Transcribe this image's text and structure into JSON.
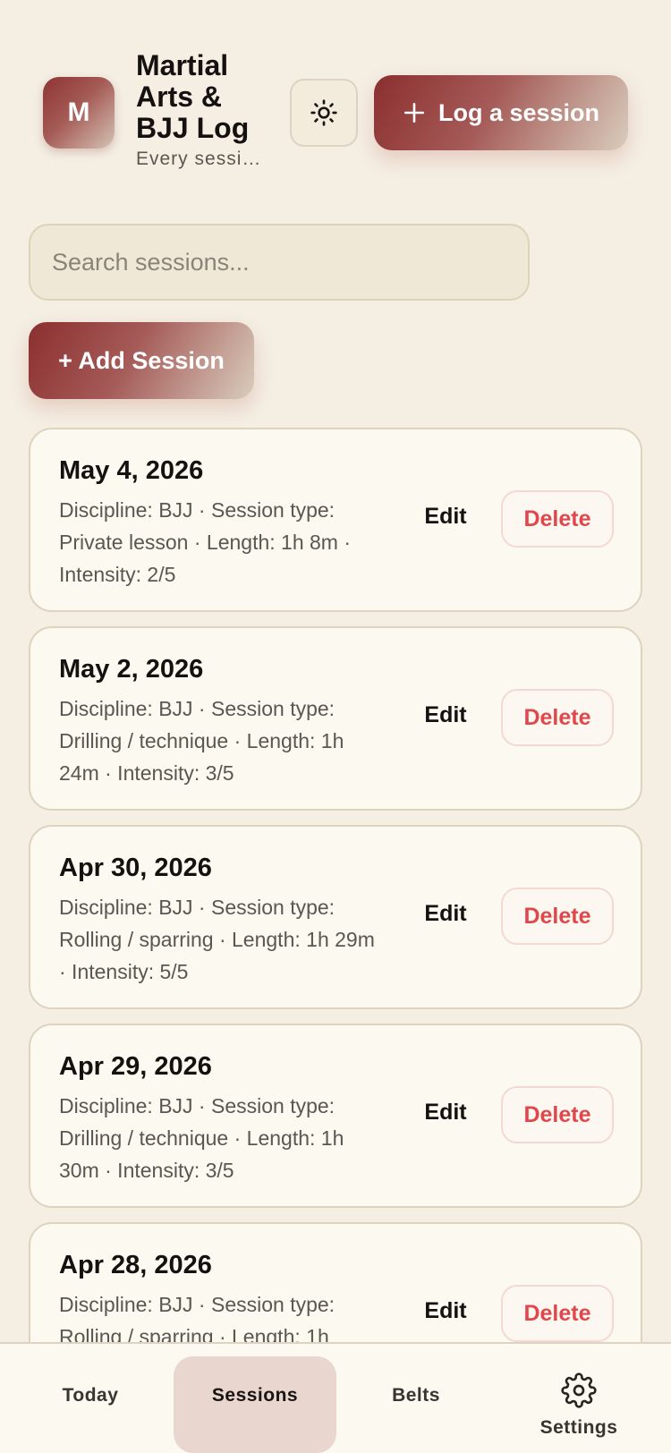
{
  "header": {
    "avatar_letter": "M",
    "title": "Martial Arts & BJJ Log",
    "subtitle": "Every sessi…",
    "theme_icon": "sun-icon",
    "log_button_icon": "plus-icon",
    "log_button_label": "Log a session"
  },
  "search": {
    "placeholder": "Search sessions...",
    "value": ""
  },
  "add_session_label": "+ Add Session",
  "sessions": [
    {
      "date": "May 4, 2026",
      "meta": "Discipline: BJJ · Session type: Private lesson · Length: 1h 8m · Intensity: 2/5",
      "edit_label": "Edit",
      "delete_label": "Delete"
    },
    {
      "date": "May 2, 2026",
      "meta": "Discipline: BJJ · Session type: Drilling / technique · Length: 1h 24m · Intensity: 3/5",
      "edit_label": "Edit",
      "delete_label": "Delete"
    },
    {
      "date": "Apr 30, 2026",
      "meta": "Discipline: BJJ · Session type: Rolling / sparring · Length: 1h 29m · Intensity: 5/5",
      "edit_label": "Edit",
      "delete_label": "Delete"
    },
    {
      "date": "Apr 29, 2026",
      "meta": "Discipline: BJJ · Session type: Drilling / technique · Length: 1h 30m · Intensity: 3/5",
      "edit_label": "Edit",
      "delete_label": "Delete"
    },
    {
      "date": "Apr 28, 2026",
      "meta": "Discipline: BJJ · Session type: Rolling / sparring · Length: 1h",
      "edit_label": "Edit",
      "delete_label": "Delete"
    }
  ],
  "tabbar": {
    "tabs": [
      {
        "label": "Today",
        "active": false
      },
      {
        "label": "Sessions",
        "active": true
      },
      {
        "label": "Belts",
        "active": false
      },
      {
        "label": "Settings",
        "active": false,
        "icon": "gear-icon"
      }
    ]
  },
  "colors": {
    "accent": "#8b2f2f",
    "danger": "#e0474a",
    "background": "#f4eee3",
    "card": "#fcf9f0",
    "active_tab": "#e8d6cf"
  }
}
